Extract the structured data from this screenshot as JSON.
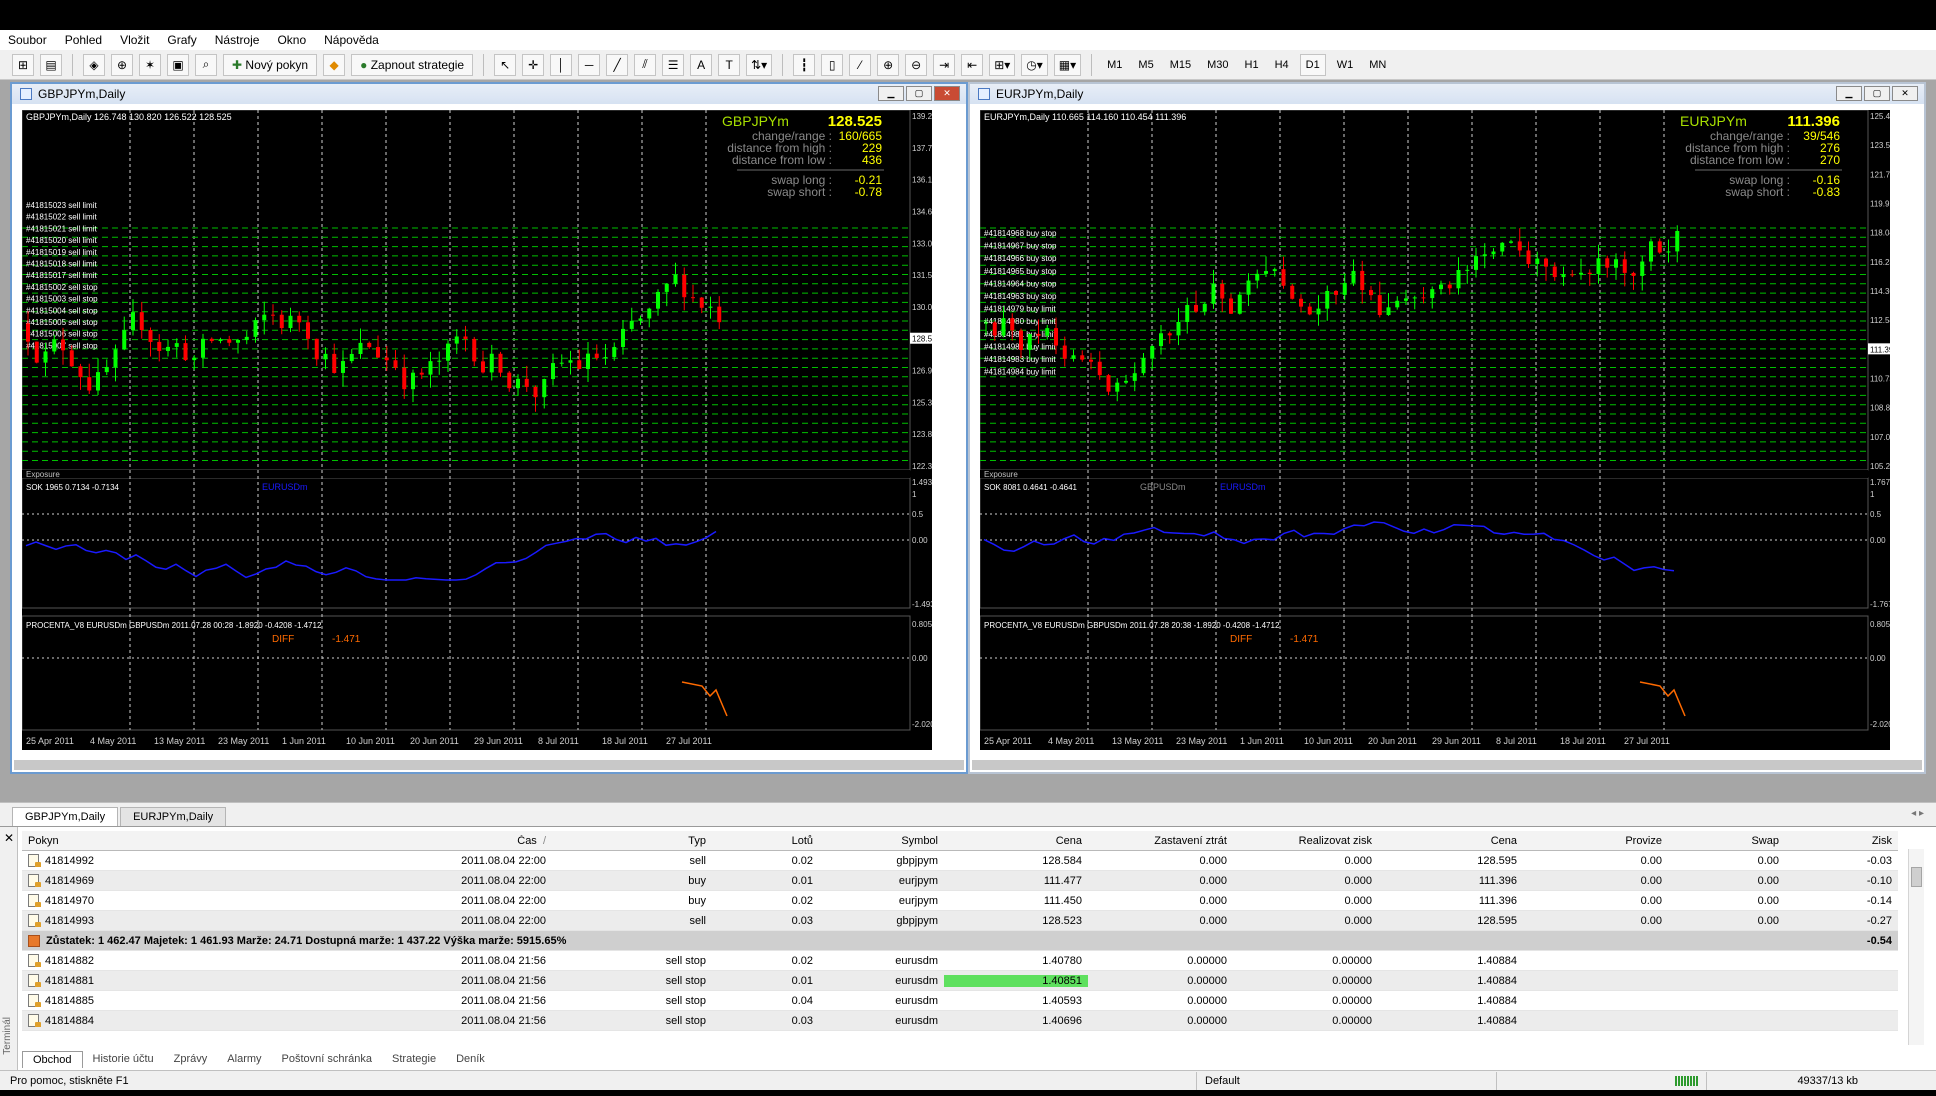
{
  "menu": [
    "Soubor",
    "Pohled",
    "Vložit",
    "Grafy",
    "Nástroje",
    "Okno",
    "Nápověda"
  ],
  "toolbar": {
    "new_order": "Nový pokyn",
    "start_strategies": "Zapnout strategie",
    "timeframes": [
      "M1",
      "M5",
      "M15",
      "M30",
      "H1",
      "H4",
      "D1",
      "W1",
      "MN"
    ],
    "active_timeframe": "D1"
  },
  "charts": [
    {
      "title": "GBPJPYm,Daily",
      "ohlc": "GBPJPYm,Daily  126.748 130.820 126.522 128.525",
      "symbol": "GBPJPYm",
      "price": "128.525",
      "change_range_label": "change/range :",
      "change_range": "160/665",
      "dist_high_label": "distance from high :",
      "dist_high": "229",
      "dist_low_label": "distance from low :",
      "dist_low": "436",
      "swap_long_label": "swap long :",
      "swap_long": "-0.21",
      "swap_short_label": "swap short :",
      "swap_short": "-0.78",
      "price_axis": [
        "139.240",
        "137.710",
        "136.180",
        "134.650",
        "133.075",
        "131.545",
        "130.015",
        "128.525",
        "126.910",
        "125.380",
        "123.850",
        "122.320"
      ],
      "orders": [
        "#41815023  sell limit",
        "#41815022  sell limit",
        "#41815021  sell limit",
        "#41815020  sell limit",
        "#41815019  sell limit",
        "#41815018  sell limit",
        "#41815017  sell limit",
        "#41815002  sell stop",
        "#41815003  sell stop",
        "#41815004  sell stop",
        "#41815005  sell stop",
        "#41815006  sell stop",
        "#41815007  sell stop"
      ],
      "exposure_label": "Exposure",
      "sok_label": "SOK 1965 0.7134 -0.7134",
      "sok_series": "EURUSDm",
      "sok_axis": [
        "1.4932",
        "1",
        "0.5",
        "0.00",
        "-1.4932"
      ],
      "proc_label": "PROCENTA_V8 EURUSDm GBPUSDm 2011.07.28 00:28  -1.8920 -0.4208 -1.4712",
      "diff_label": "DIFF",
      "diff_value": "-1.471",
      "proc_axis": [
        "0.8054",
        "0.00",
        "-2.0205"
      ],
      "dates": [
        "25 Apr 2011",
        "4 May 2011",
        "13 May 2011",
        "23 May 2011",
        "1 Jun 2011",
        "10 Jun 2011",
        "20 Jun 2011",
        "29 Jun 2011",
        "8 Jul 2011",
        "18 Jul 2011",
        "27 Jul 2011"
      ]
    },
    {
      "title": "EURJPYm,Daily",
      "ohlc": "EURJPYm,Daily  110.665 114.160 110.454 111.396",
      "symbol": "EURJPYm",
      "price": "111.396",
      "change_range_label": "change/range :",
      "change_range": "39/546",
      "dist_high_label": "distance from high :",
      "dist_high": "276",
      "dist_low_label": "distance from low :",
      "dist_low": "270",
      "swap_long_label": "swap long :",
      "swap_long": "-0.16",
      "swap_short_label": "swap short :",
      "swap_short": "-0.83",
      "price_axis": [
        "125.415",
        "123.550",
        "121.730",
        "119.915",
        "118.045",
        "116.230",
        "114.360",
        "112.545",
        "111.396",
        "110.730",
        "108.860",
        "107.045",
        "105.230"
      ],
      "orders": [
        "#41814968  buy stop",
        "#41814967  buy stop",
        "#41814966  buy stop",
        "#41814965  buy stop",
        "#41814964  buy stop",
        "#41814963  buy stop",
        "#41814979  buy limit",
        "#41814980  buy limit",
        "#41814981  buy limit",
        "#41814982  buy limit",
        "#41814983  buy limit",
        "#41814984  buy limit"
      ],
      "exposure_label": "Exposure",
      "sok_label": "SOK 8081 0.4641 -0.4641",
      "sok_series": "GBPUSDm",
      "sok_series2": "EURUSDm",
      "sok_axis": [
        "1.7679",
        "1",
        "0.5",
        "0.00",
        "-1.7679"
      ],
      "proc_label": "PROCENTA_V8 EURUSDm GBPUSDm 2011.07.28 20:38  -1.8920 -0.4208 -1.4712",
      "diff_label": "DIFF",
      "diff_value": "-1.471",
      "proc_axis": [
        "0.8054",
        "0.00",
        "-2.0205"
      ],
      "dates": [
        "25 Apr 2011",
        "4 May 2011",
        "13 May 2011",
        "23 May 2011",
        "1 Jun 2011",
        "10 Jun 2011",
        "20 Jun 2011",
        "29 Jun 2011",
        "8 Jul 2011",
        "18 Jul 2011",
        "27 Jul 2011"
      ]
    }
  ],
  "chart_tabs": [
    "GBPJPYm,Daily",
    "EURJPYm,Daily"
  ],
  "tab_nav": "◂ ▸",
  "terminal": {
    "side_label": "Terminál",
    "columns": [
      "Pokyn",
      "Čas",
      "Typ",
      "Lotů",
      "Symbol",
      "Cena",
      "Zastavení ztrát",
      "Realizovat zisk",
      "Cena",
      "Provize",
      "Swap",
      "Zisk"
    ],
    "sort_mark": "/",
    "open_orders": [
      {
        "id": "41814992",
        "time": "2011.08.04 22:00",
        "type": "sell",
        "lots": "0.02",
        "symbol": "gbpjpym",
        "price": "128.584",
        "sl": "0.000",
        "tp": "0.000",
        "cur": "128.595",
        "comm": "0.00",
        "swap": "0.00",
        "profit": "-0.03"
      },
      {
        "id": "41814969",
        "time": "2011.08.04 22:00",
        "type": "buy",
        "lots": "0.01",
        "symbol": "eurjpym",
        "price": "111.477",
        "sl": "0.000",
        "tp": "0.000",
        "cur": "111.396",
        "comm": "0.00",
        "swap": "0.00",
        "profit": "-0.10"
      },
      {
        "id": "41814970",
        "time": "2011.08.04 22:00",
        "type": "buy",
        "lots": "0.02",
        "symbol": "eurjpym",
        "price": "111.450",
        "sl": "0.000",
        "tp": "0.000",
        "cur": "111.396",
        "comm": "0.00",
        "swap": "0.00",
        "profit": "-0.14"
      },
      {
        "id": "41814993",
        "time": "2011.08.04 22:00",
        "type": "sell",
        "lots": "0.03",
        "symbol": "gbpjpym",
        "price": "128.523",
        "sl": "0.000",
        "tp": "0.000",
        "cur": "128.595",
        "comm": "0.00",
        "swap": "0.00",
        "profit": "-0.27"
      }
    ],
    "summary": "Zůstatek: 1 462.47  Majetek: 1 461.93  Marže: 24.71  Dostupná marže: 1 437.22  Výška marže: 5915.65%",
    "summary_profit": "-0.54",
    "pending_orders": [
      {
        "id": "41814882",
        "time": "2011.08.04 21:56",
        "type": "sell stop",
        "lots": "0.02",
        "symbol": "eurusdm",
        "price": "1.40780",
        "sl": "0.00000",
        "tp": "0.00000",
        "cur": "1.40884"
      },
      {
        "id": "41814881",
        "time": "2011.08.04 21:56",
        "type": "sell stop",
        "lots": "0.01",
        "symbol": "eurusdm",
        "price": "1.40851",
        "sl": "0.00000",
        "tp": "0.00000",
        "cur": "1.40884"
      },
      {
        "id": "41814885",
        "time": "2011.08.04 21:56",
        "type": "sell stop",
        "lots": "0.04",
        "symbol": "eurusdm",
        "price": "1.40593",
        "sl": "0.00000",
        "tp": "0.00000",
        "cur": "1.40884"
      },
      {
        "id": "41814884",
        "time": "2011.08.04 21:56",
        "type": "sell stop",
        "lots": "0.03",
        "symbol": "eurusdm",
        "price": "1.40696",
        "sl": "0.00000",
        "tp": "0.00000",
        "cur": "1.40884"
      }
    ],
    "bottom_tabs": [
      "Obchod",
      "Historie účtu",
      "Zprávy",
      "Alarmy",
      "Poštovní schránka",
      "Strategie",
      "Deník"
    ]
  },
  "status": {
    "help": "Pro pomoc, stiskněte F1",
    "profile": "Default",
    "traffic": "49337/13 kb"
  },
  "colors": {
    "bull": "#00ff00",
    "bear": "#ff0000",
    "grid": "#00c000",
    "osc": "#1a1aff",
    "diff": "#ff6a00",
    "panel_text": "#c0c0c0",
    "price_value": "#ffff00",
    "symbol_text": "#a8e000",
    "highlight": "#5ee05e"
  }
}
